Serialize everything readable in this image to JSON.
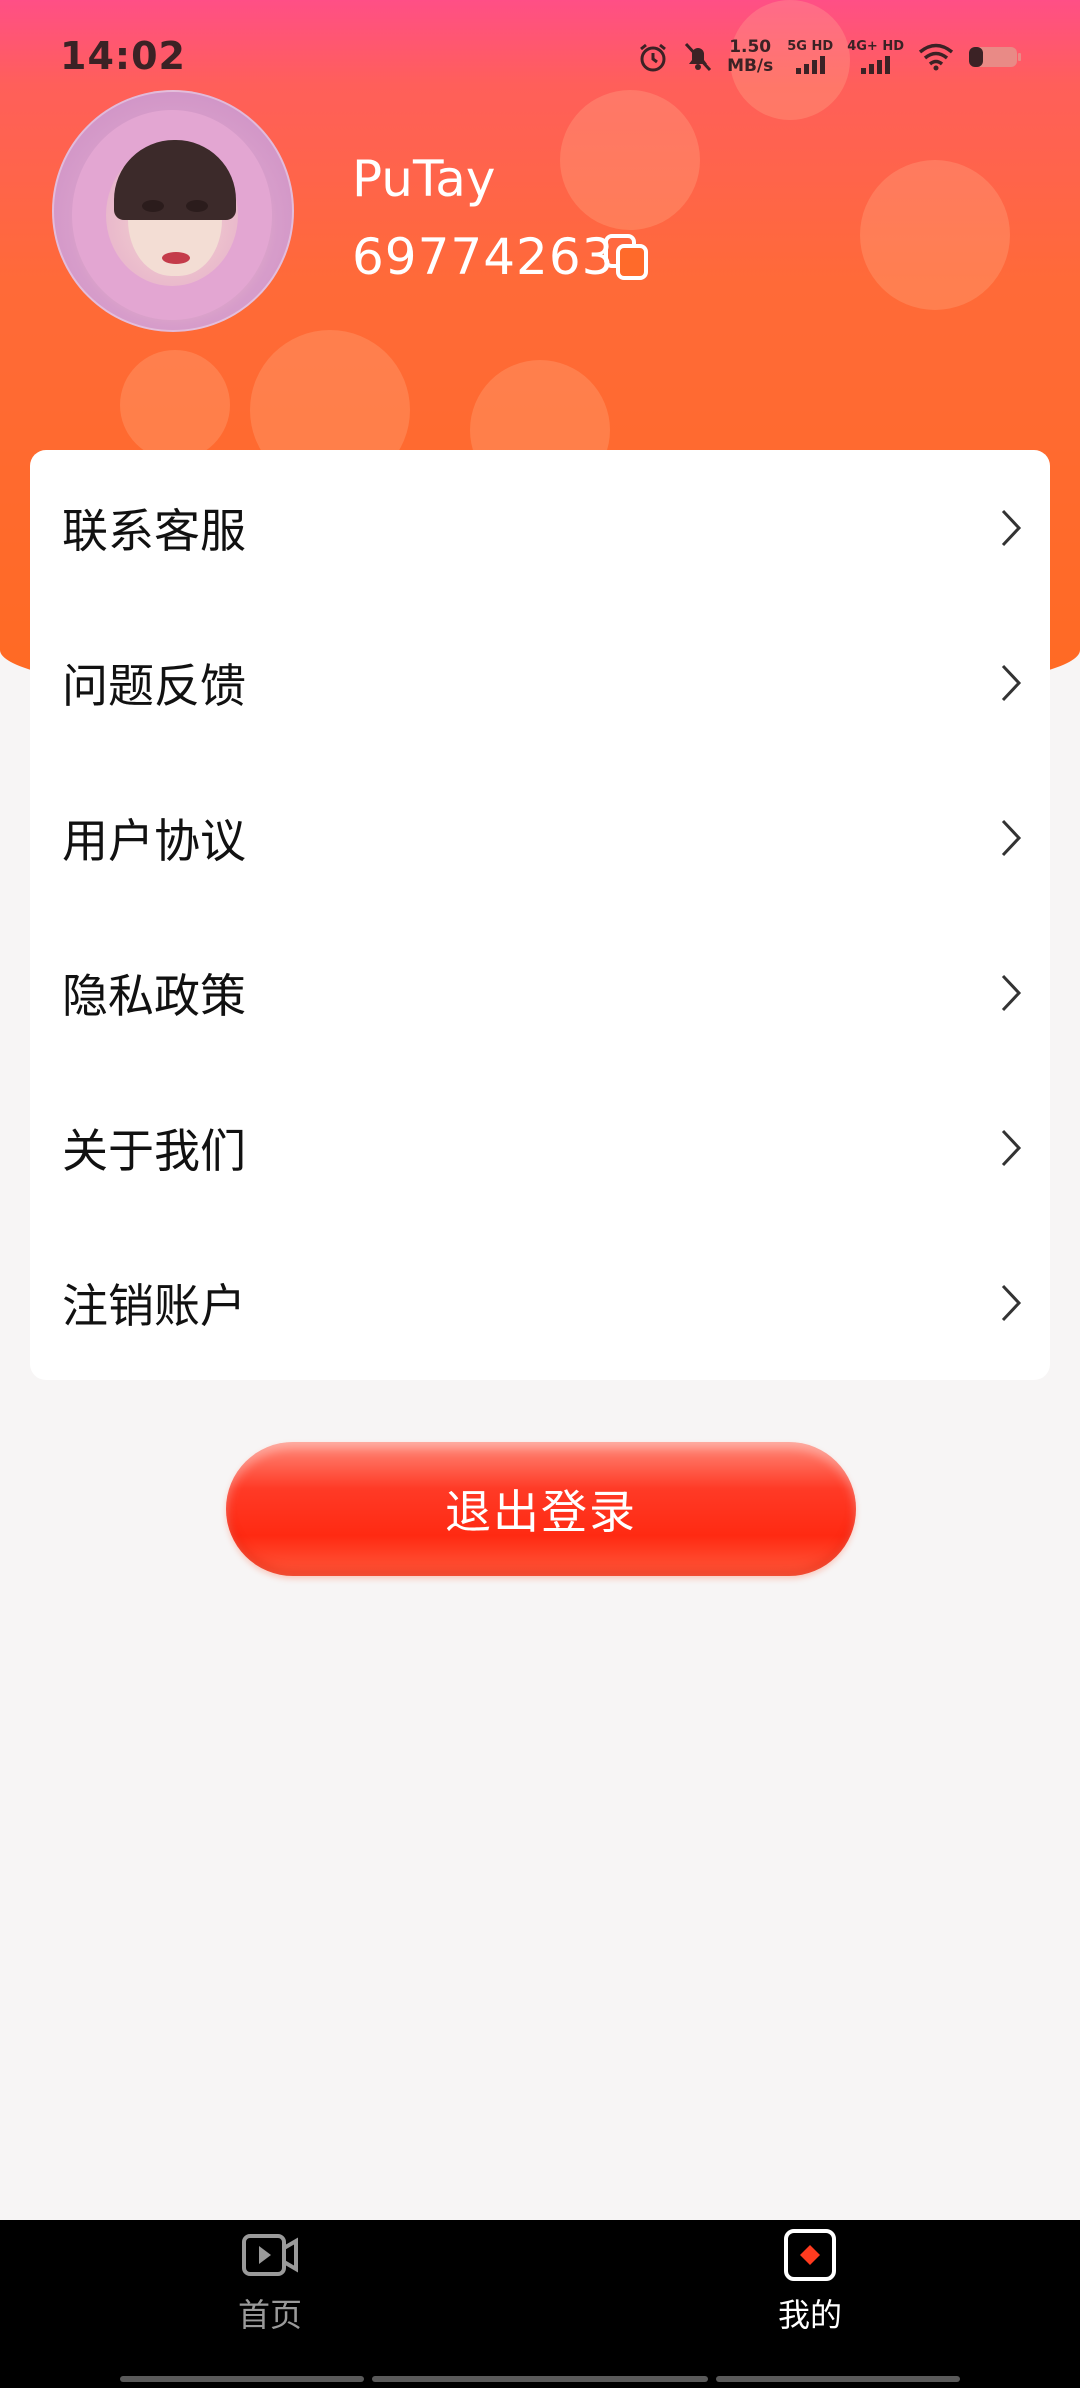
{
  "status_bar": {
    "time": "14:02",
    "net_speed_value": "1.50",
    "net_speed_unit": "MB/s",
    "sim1_label": "5G HD",
    "sim2_label": "4G+ HD",
    "icons": [
      "alarm-icon",
      "mute-bell-icon",
      "signal-icon",
      "wifi-icon",
      "battery-icon"
    ]
  },
  "profile": {
    "username": "PuTay",
    "user_id": "69774263"
  },
  "menu": {
    "items": [
      {
        "label": "联系客服"
      },
      {
        "label": "问题反馈"
      },
      {
        "label": "用户协议"
      },
      {
        "label": "隐私政策"
      },
      {
        "label": "关于我们"
      },
      {
        "label": "注销账户"
      }
    ]
  },
  "logout": {
    "label": "退出登录"
  },
  "bottom_nav": {
    "items": [
      {
        "label": "首页",
        "icon": "video-play-icon",
        "active": false
      },
      {
        "label": "我的",
        "icon": "profile-square-icon",
        "active": true
      }
    ]
  },
  "colors": {
    "header_top": "#ff4f86",
    "header_bottom": "#ff6a22",
    "logout_red": "#ff2a12",
    "nav_bg": "#000000",
    "active_accent": "#ff3b1f"
  }
}
